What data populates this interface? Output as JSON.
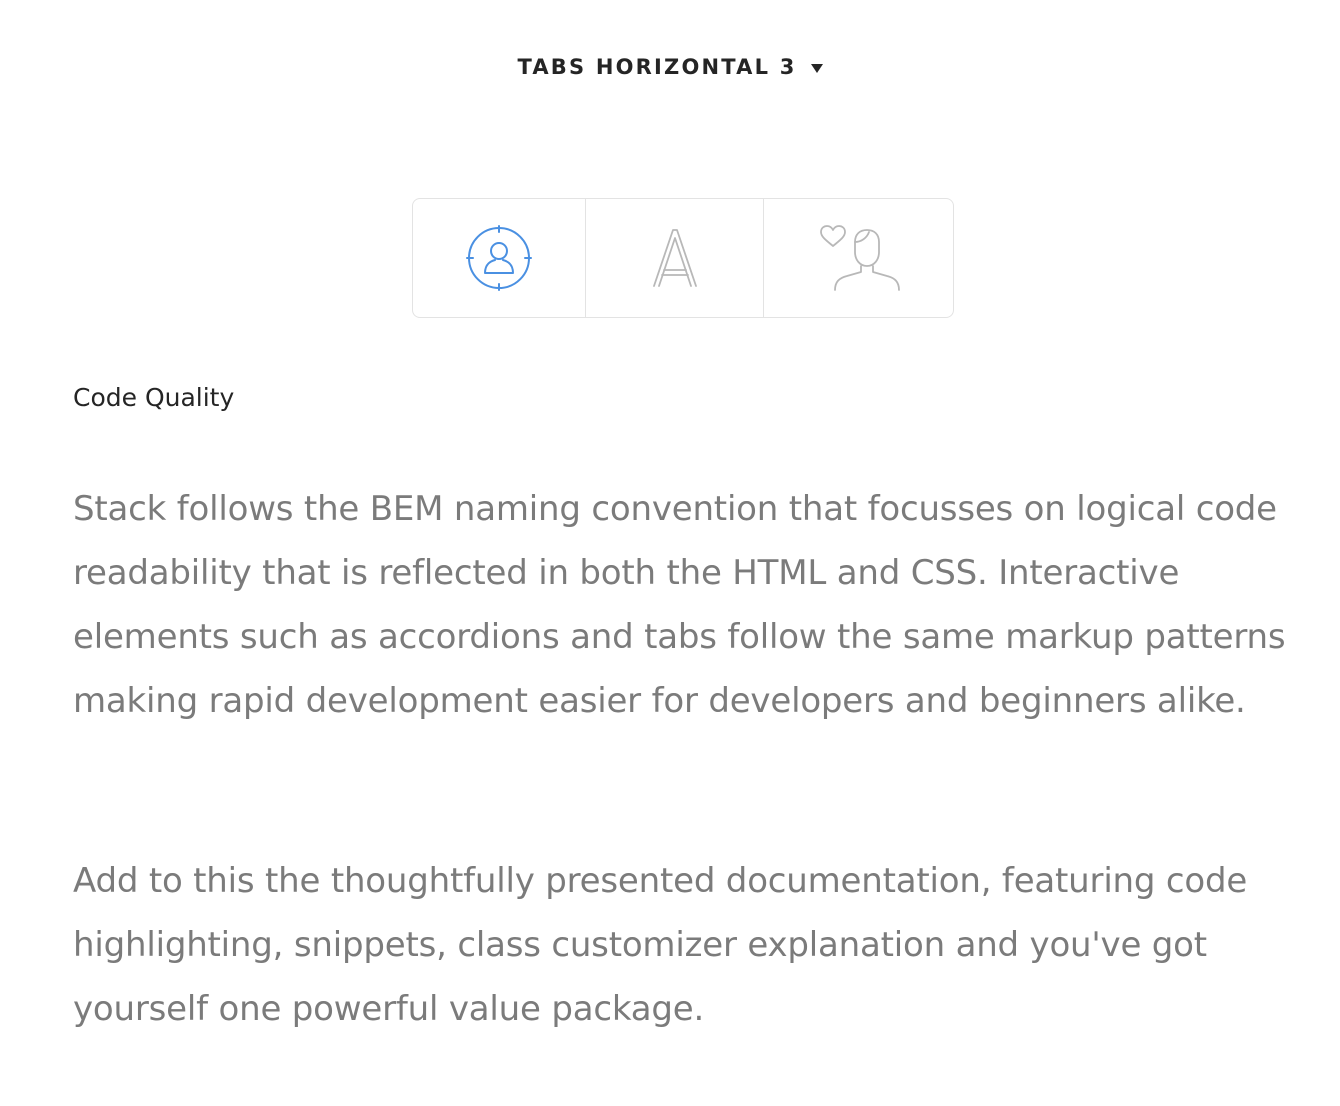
{
  "dropdown": {
    "label": "TABS HORIZONTAL 3",
    "icon": "caret-down-icon"
  },
  "tabs": [
    {
      "icon": "user-target-icon",
      "active": true,
      "color": "#4a90e2"
    },
    {
      "icon": "letter-a-icon",
      "active": false,
      "color": "#b8b8b8"
    },
    {
      "icon": "user-heart-icon",
      "active": false,
      "color": "#b8b8b8"
    }
  ],
  "content": {
    "title": "Code Quality",
    "paragraphs": [
      "Stack follows the BEM naming convention that focusses on logical code readability that is reflected in both the HTML and CSS. Interactive elements such as accordions and tabs follow the same markup patterns making rapid development easier for developers and beginners alike.",
      "Add to this the thoughtfully presented documentation, featuring code highlighting, snippets, class customizer explanation and you've got yourself one powerful value package."
    ]
  },
  "colors": {
    "accent": "#4a90e2",
    "heading": "#252525",
    "body_text": "#7b7b7b",
    "border": "#e3e3e3"
  }
}
